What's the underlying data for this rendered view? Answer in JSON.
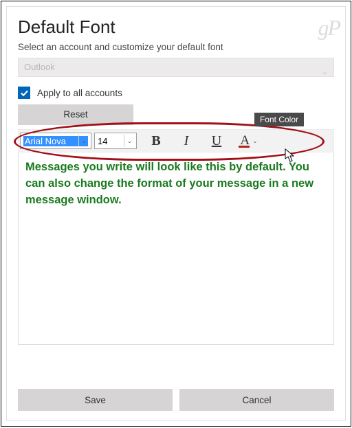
{
  "watermark": "gP",
  "title": "Default Font",
  "subtitle": "Select an account and customize your default font",
  "account": {
    "value": "Outlook"
  },
  "apply_all": {
    "label": "Apply to all accounts",
    "checked": true
  },
  "reset_label": "Reset",
  "toolbar": {
    "font_name": "Arial Nova",
    "font_size": "14",
    "bold": "B",
    "italic": "I",
    "underline": "U",
    "font_color_glyph": "A",
    "tooltip": "Font Color"
  },
  "preview": {
    "text": "Messages you write will look like this by default. You can also change the format of your message in a new message window.",
    "color": "#1a7a1f"
  },
  "buttons": {
    "save": "Save",
    "cancel": "Cancel"
  }
}
